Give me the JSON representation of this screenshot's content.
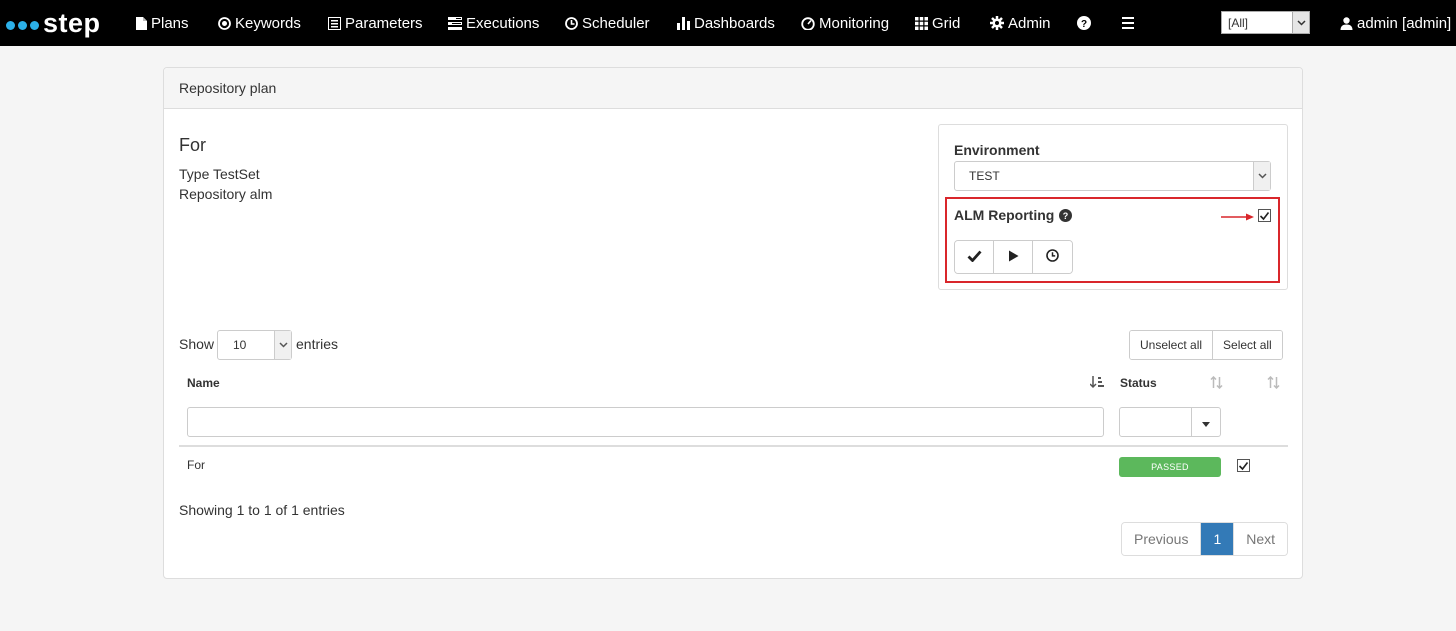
{
  "navbar": {
    "logo_text": "step",
    "items": [
      {
        "label": "Plans",
        "icon": "file-icon"
      },
      {
        "label": "Keywords",
        "icon": "dot-circle-icon"
      },
      {
        "label": "Parameters",
        "icon": "list-alt-icon"
      },
      {
        "label": "Executions",
        "icon": "tasks-icon"
      },
      {
        "label": "Scheduler",
        "icon": "clock-icon"
      },
      {
        "label": "Dashboards",
        "icon": "bar-chart-icon"
      },
      {
        "label": "Monitoring",
        "icon": "dashboard-icon"
      },
      {
        "label": "Grid",
        "icon": "grid-icon"
      },
      {
        "label": "Admin",
        "icon": "cog-icon"
      }
    ],
    "help_icon": "question-circle-icon",
    "menu_icon": "hamburger-icon",
    "tenant_select": "[All]",
    "user": "admin [admin]",
    "user_icon": "user-icon"
  },
  "panel": {
    "heading": "Repository plan",
    "plan_name": "For",
    "type_line": "Type TestSet",
    "repository_line": "Repository alm"
  },
  "environment": {
    "label": "Environment",
    "value": "TEST",
    "alm_reporting_label": "ALM Reporting",
    "alm_reporting_checked": true,
    "buttons": [
      "check-icon",
      "play-icon",
      "clock-icon"
    ]
  },
  "table": {
    "show_label": "Show",
    "length_value": "10",
    "entries_label": "entries",
    "unselect_all": "Unselect all",
    "select_all": "Select all",
    "columns": [
      "Name",
      "Status"
    ],
    "rows": [
      {
        "name": "For",
        "status": "PASSED",
        "selected": true
      }
    ],
    "info": "Showing 1 to 1 of 1 entries",
    "pagination": {
      "previous": "Previous",
      "current": "1",
      "next": "Next"
    }
  },
  "colors": {
    "navbar_bg": "#000000",
    "logo_dots": "#2cb0e8",
    "passed": "#5cb85c",
    "page_active": "#337ab7",
    "highlight": "#d9262b"
  }
}
